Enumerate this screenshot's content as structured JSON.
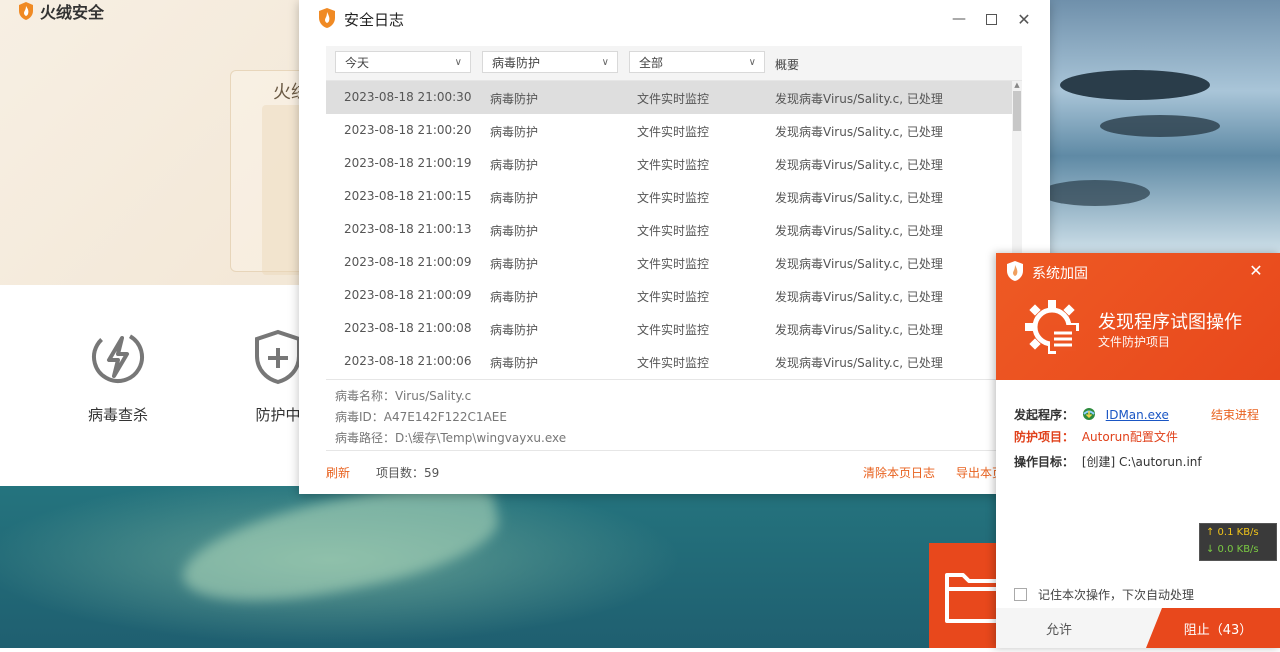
{
  "main_app": {
    "logo_text": "火绒安全",
    "hero_title": "火绒",
    "features": [
      {
        "label": "病毒查杀",
        "icon": "lightning-circle-icon"
      },
      {
        "label": "防护中",
        "icon": "shield-plus-icon"
      }
    ]
  },
  "log_window": {
    "title": "安全日志",
    "filters": {
      "date": "今天",
      "category": "病毒防护",
      "type": "全部",
      "summary_header": "概要"
    },
    "rows": [
      {
        "time": "2023-08-18 21:00:30",
        "category": "病毒防护",
        "source": "文件实时监控",
        "summary": "发现病毒Virus/Sality.c, 已处理"
      },
      {
        "time": "2023-08-18 21:00:20",
        "category": "病毒防护",
        "source": "文件实时监控",
        "summary": "发现病毒Virus/Sality.c, 已处理"
      },
      {
        "time": "2023-08-18 21:00:19",
        "category": "病毒防护",
        "source": "文件实时监控",
        "summary": "发现病毒Virus/Sality.c, 已处理"
      },
      {
        "time": "2023-08-18 21:00:15",
        "category": "病毒防护",
        "source": "文件实时监控",
        "summary": "发现病毒Virus/Sality.c, 已处理"
      },
      {
        "time": "2023-08-18 21:00:13",
        "category": "病毒防护",
        "source": "文件实时监控",
        "summary": "发现病毒Virus/Sality.c, 已处理"
      },
      {
        "time": "2023-08-18 21:00:09",
        "category": "病毒防护",
        "source": "文件实时监控",
        "summary": "发现病毒Virus/Sality.c, 已处理"
      },
      {
        "time": "2023-08-18 21:00:09",
        "category": "病毒防护",
        "source": "文件实时监控",
        "summary": "发现病毒Virus/Sality.c, 已处理"
      },
      {
        "time": "2023-08-18 21:00:08",
        "category": "病毒防护",
        "source": "文件实时监控",
        "summary": "发现病毒Virus/Sality.c, 已处理"
      },
      {
        "time": "2023-08-18 21:00:06",
        "category": "病毒防护",
        "source": "文件实时监控",
        "summary": "发现病毒Virus/Sality.c, 已处理"
      }
    ],
    "detail": {
      "virus_name": "病毒名称：Virus/Sality.c",
      "virus_id": "病毒ID：A47E142F122C1AEE",
      "virus_path": "病毒路径：D:\\缓存\\Temp\\wingvayxu.exe"
    },
    "footer": {
      "refresh": "刷新",
      "item_count": "项目数：59",
      "clear_page": "清除本页日志",
      "export_page": "导出本页"
    }
  },
  "popup": {
    "title": "系统加固",
    "headline": "发现程序试图操作",
    "subline": "文件防护项目",
    "initiator_label": "发起程序：",
    "initiator_value": "IDMan.exe",
    "end_process": "结束进程",
    "protect_label": "防护项目：",
    "protect_value": "Autorun配置文件",
    "target_label": "操作目标：",
    "target_value": "[创建] C:\\autorun.inf",
    "remember": "记住本次操作，下次自动处理",
    "allow": "允许",
    "block": "阻止（43）",
    "accent_color": "#e8481c"
  },
  "net_widget": {
    "up": "↑ 0.1 KB/s",
    "down": "↓ 0.0 KB/s"
  }
}
